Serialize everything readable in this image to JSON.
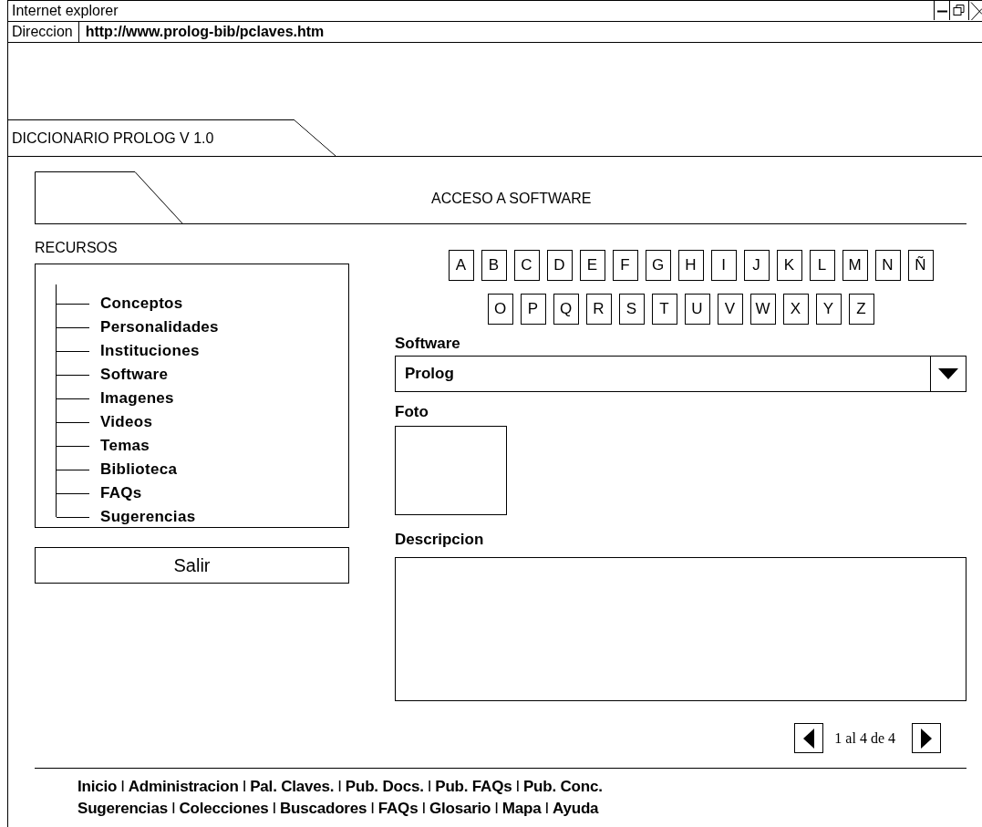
{
  "window": {
    "title": "Internet explorer"
  },
  "address_bar": {
    "label": "Direccion",
    "value": "http://www.prolog-bib/pclaves.htm"
  },
  "app_tab": {
    "label": "DICCIONARIO PROLOG V 1.0"
  },
  "section_title": "ACCESO A SOFTWARE",
  "sidebar": {
    "title": "RECURSOS",
    "items": [
      "Conceptos",
      "Personalidades",
      "Instituciones",
      "Software",
      "Imagenes",
      "Videos",
      "Temas",
      "Biblioteca",
      "FAQs",
      "Sugerencias"
    ],
    "exit_button": "Salir"
  },
  "letters": [
    [
      "A",
      "B",
      "C",
      "D",
      "E",
      "F",
      "G",
      "H",
      "I",
      "J",
      "K",
      "L",
      "M",
      "N",
      "Ñ"
    ],
    [
      "O",
      "P",
      "Q",
      "R",
      "S",
      "T",
      "U",
      "V",
      "W",
      "X",
      "Y",
      "Z"
    ]
  ],
  "software": {
    "label": "Software",
    "value": "Prolog"
  },
  "photo": {
    "label": "Foto"
  },
  "description": {
    "label": "Descripcion"
  },
  "pager": {
    "text": "1 al 4 de 4"
  },
  "footer": {
    "lines": [
      [
        {
          "kind": "link",
          "text": "Inicio"
        },
        {
          "kind": "separator",
          "text": "I"
        },
        {
          "kind": "link",
          "text": "Administracion"
        },
        {
          "kind": "separator",
          "text": "I"
        },
        {
          "kind": "link",
          "text": "Pal. Claves."
        },
        {
          "kind": "separator",
          "text": "I"
        },
        {
          "kind": "link",
          "text": "Pub. Docs."
        },
        {
          "kind": "separator",
          "text": "I"
        },
        {
          "kind": "link",
          "text": "Pub. FAQs"
        },
        {
          "kind": "separator",
          "text": "I"
        },
        {
          "kind": "link",
          "text": "Pub. Conc."
        }
      ],
      [
        {
          "kind": "link",
          "text": "Sugerencias"
        },
        {
          "kind": "separator",
          "text": "I"
        },
        {
          "kind": "link",
          "text": "Colecciones"
        },
        {
          "kind": "separator",
          "text": "I"
        },
        {
          "kind": "link",
          "text": "Buscadores"
        },
        {
          "kind": "separator",
          "text": "I"
        },
        {
          "kind": "link",
          "text": "FAQs"
        },
        {
          "kind": "separator",
          "text": "I"
        },
        {
          "kind": "link",
          "text": "Glosario"
        },
        {
          "kind": "separator",
          "text": "I"
        },
        {
          "kind": "link",
          "text": "Mapa"
        },
        {
          "kind": "separator",
          "text": "I"
        },
        {
          "kind": "link",
          "text": "Ayuda"
        }
      ]
    ]
  }
}
